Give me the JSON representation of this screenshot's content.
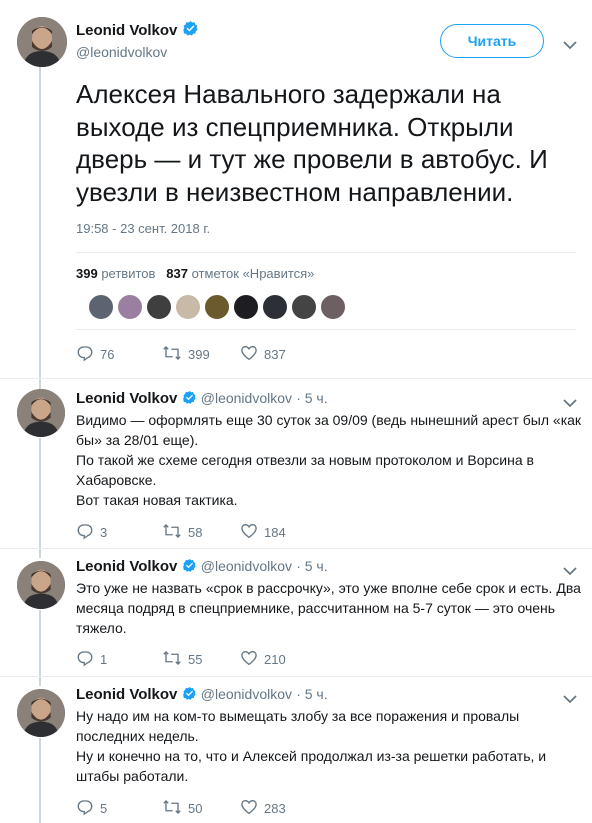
{
  "main": {
    "name": "Leonid Volkov",
    "handle": "@leonidvolkov",
    "follow_label": "Читать",
    "text": "Алексея Навального задержали на выходе из спецприемника. Открыли дверь — и тут же провели в автобус. И увезли в неизвестном направлении.",
    "timestamp": "19:58 - 23 сент. 2018 г.",
    "retweets_count": "399",
    "retweets_label": "ретвитов",
    "likes_count": "837",
    "likes_label": "отметок «Нравится»",
    "actions": {
      "replies": "76",
      "retweets": "399",
      "likes": "837"
    }
  },
  "replies": [
    {
      "name": "Leonid Volkov",
      "handle": "@leonidvolkov",
      "time": "· 5 ч.",
      "paragraphs": [
        "Видимо — оформлять еще 30 суток за 09/09 (ведь нынешний арест был «как бы» за 28/01 еще).",
        "По такой же схеме сегодня отвезли за новым протоколом и Ворсина в Хабаровске.",
        "Вот такая новая тактика."
      ],
      "actions": {
        "replies": "3",
        "retweets": "58",
        "likes": "184"
      }
    },
    {
      "name": "Leonid Volkov",
      "handle": "@leonidvolkov",
      "time": "· 5 ч.",
      "paragraphs": [
        "Это уже не назвать «срок в рассрочку», это уже вполне себе срок и есть. Два месяца подряд в спецприемнике, рассчитанном на 5-7 суток — это очень тяжело."
      ],
      "actions": {
        "replies": "1",
        "retweets": "55",
        "likes": "210"
      }
    },
    {
      "name": "Leonid Volkov",
      "handle": "@leonidvolkov",
      "time": "· 5 ч.",
      "paragraphs": [
        "Ну надо им на ком-то вымещать злобу за все поражения и провалы последних недель.",
        "Ну и конечно на то, что и Алексей продолжал из-за решетки работать, и штабы работали."
      ],
      "actions": {
        "replies": "5",
        "retweets": "50",
        "likes": "283"
      }
    }
  ],
  "colors": {
    "accent": "#1da1f2",
    "muted": "#657786",
    "text": "#14171a",
    "thread_line": "#ccd6dd"
  }
}
